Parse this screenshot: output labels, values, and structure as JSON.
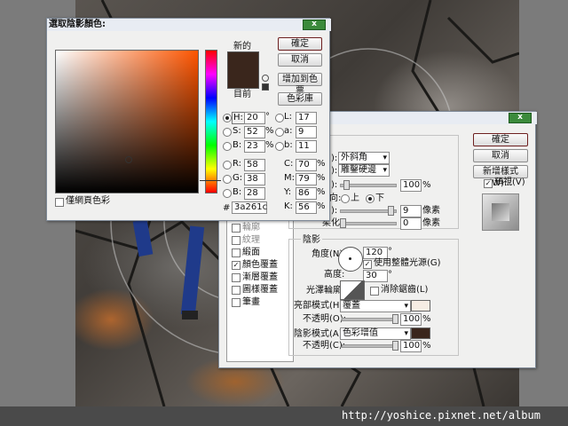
{
  "picker": {
    "title": "選取陰影顏色:",
    "close": "x",
    "new_label": "新的",
    "current_label": "目前",
    "ok": "確定",
    "cancel": "取消",
    "add_swatch": "增加到色票",
    "color_library": "色彩庫",
    "web_colors_only": "僅網頁色彩",
    "hex_prefix": "#",
    "hex": "3a261c",
    "current_color": "#3a261c",
    "hue_selected": true,
    "fields": {
      "H": {
        "label": "H:",
        "value": "20",
        "unit": "°"
      },
      "S": {
        "label": "S:",
        "value": "52",
        "unit": "%"
      },
      "B": {
        "label": "B:",
        "value": "23",
        "unit": "%"
      },
      "R": {
        "label": "R:",
        "value": "58",
        "unit": ""
      },
      "G": {
        "label": "G:",
        "value": "38",
        "unit": ""
      },
      "Bl": {
        "label": "B:",
        "value": "28",
        "unit": ""
      },
      "L": {
        "label": "L:",
        "value": "17",
        "unit": ""
      },
      "a": {
        "label": "a:",
        "value": "9",
        "unit": ""
      },
      "b": {
        "label": "b:",
        "value": "11",
        "unit": ""
      },
      "C": {
        "label": "C:",
        "value": "70",
        "unit": "%"
      },
      "M": {
        "label": "M:",
        "value": "79",
        "unit": "%"
      },
      "Y": {
        "label": "Y:",
        "value": "86",
        "unit": "%"
      },
      "K": {
        "label": "K:",
        "value": "56",
        "unit": "%"
      }
    }
  },
  "layer_style": {
    "close": "x",
    "ok": "確定",
    "cancel": "取消",
    "new_style": "新增樣式(W)...",
    "preview": "預視(V)",
    "structure": {
      "style_label": "):",
      "style_value": "外斜角",
      "technique_label": "):",
      "technique_value": "雕鑿硬邊",
      "depth_label": "):",
      "depth_value": "100",
      "depth_unit": "%",
      "direction_label": "向:",
      "direction_up": "上",
      "direction_down": "下",
      "size_label": "):",
      "size_value": "9",
      "size_unit": "像素",
      "soften_label": "柔化:",
      "soften_value": "0",
      "soften_unit": "像素"
    },
    "shading": {
      "section": "陰影",
      "angle_label": "角度(N):",
      "angle_value": "120",
      "angle_unit": "°",
      "global_light": "使用整體光源(G)",
      "altitude_label": "高度:",
      "altitude_value": "30",
      "altitude_unit": "°",
      "gloss_label": "光澤輪廓:",
      "anti_alias": "消除鋸齒(L)",
      "highlight_label": "亮部模式(H):",
      "highlight_value": "覆蓋",
      "highlight_color": "#f6ede4",
      "hl_opacity_label": "不透明(O):",
      "hl_opacity_value": "100",
      "hl_opacity_unit": "%",
      "shadow_label": "陰影模式(A):",
      "shadow_value": "色彩增值",
      "shadow_color": "#3a261c",
      "sh_opacity_label": "不透明(C):",
      "sh_opacity_value": "100",
      "sh_opacity_unit": "%"
    },
    "sidebar": [
      {
        "label": "輪廓",
        "checked": false,
        "dim": true
      },
      {
        "label": "紋理",
        "checked": false,
        "dim": true
      },
      {
        "label": "緞面",
        "checked": false,
        "dim": false
      },
      {
        "label": "顏色覆蓋",
        "checked": true,
        "dim": false
      },
      {
        "label": "漸層覆蓋",
        "checked": false,
        "dim": false
      },
      {
        "label": "圖樣覆蓋",
        "checked": false,
        "dim": false
      },
      {
        "label": "筆畫",
        "checked": false,
        "dim": false
      }
    ]
  },
  "watermark": "http://yoshice.pixnet.net/album"
}
